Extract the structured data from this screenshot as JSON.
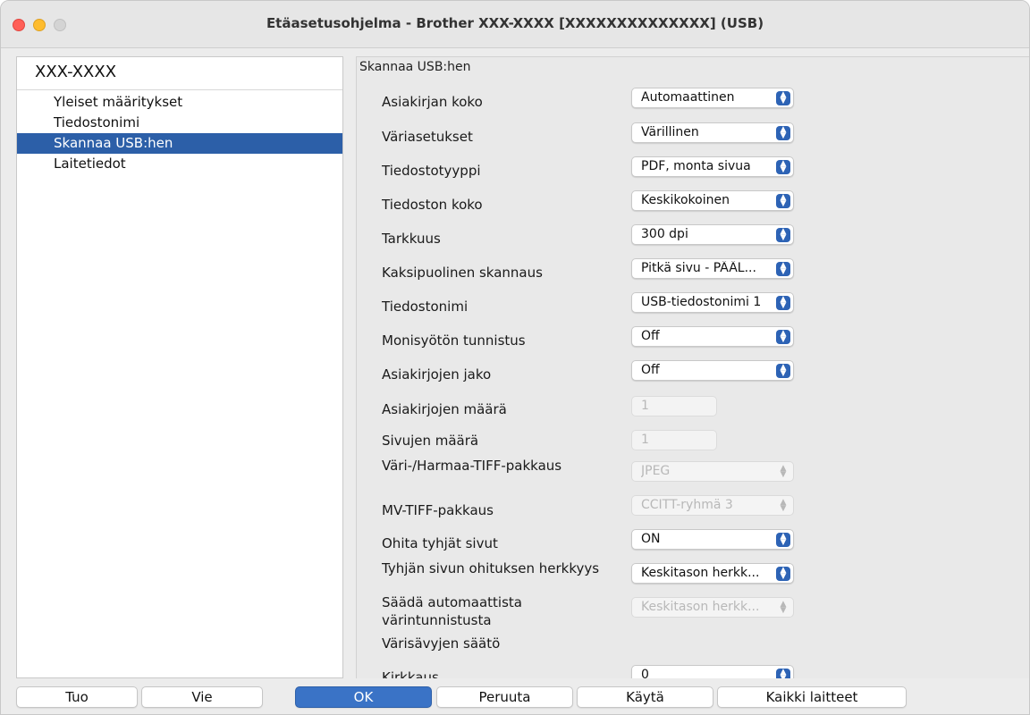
{
  "window": {
    "title": "Etäasetusohjelma - Brother XXX-XXXX [XXXXXXXXXXXXXX] (USB)"
  },
  "sidebar": {
    "header": "XXX-XXXX",
    "items": [
      {
        "label": "Yleiset määritykset"
      },
      {
        "label": "Tiedostonimi"
      },
      {
        "label": "Skannaa USB:hen",
        "selected": true
      },
      {
        "label": "Laitetiedot"
      }
    ]
  },
  "panel": {
    "section_title": "Skannaa USB:hen",
    "rows": [
      {
        "label": "Asiakirjan koko",
        "control": "popup",
        "value": "Automaattinen",
        "enabled": true
      },
      {
        "label": "Väriasetukset",
        "control": "popup",
        "value": "Värillinen",
        "enabled": true
      },
      {
        "label": "Tiedostotyyppi",
        "control": "popup",
        "value": "PDF, monta sivua",
        "enabled": true
      },
      {
        "label": "Tiedoston koko",
        "control": "popup",
        "value": "Keskikokoinen",
        "enabled": true
      },
      {
        "label": "Tarkkuus",
        "control": "popup",
        "value": "300 dpi",
        "enabled": true
      },
      {
        "label": "Kaksipuolinen skannaus",
        "control": "popup",
        "value": "Pitkä sivu - PÄÄL...",
        "enabled": true
      },
      {
        "label": "Tiedostonimi",
        "control": "popup",
        "value": "USB-tiedostonimi 1",
        "enabled": true
      },
      {
        "label": "Monisyötön tunnistus",
        "control": "popup",
        "value": "Off",
        "enabled": true
      },
      {
        "label": "Asiakirjojen jako",
        "control": "popup",
        "value": "Off",
        "enabled": true
      },
      {
        "label": "Asiakirjojen määrä",
        "control": "field",
        "value": "1",
        "enabled": false
      },
      {
        "label": "Sivujen määrä",
        "control": "field",
        "value": "1",
        "enabled": false
      },
      {
        "label": "Väri-/Harmaa-TIFF-pakkaus",
        "control": "popup",
        "value": "JPEG",
        "enabled": false
      },
      {
        "label": "MV-TIFF-pakkaus",
        "control": "popup",
        "value": "CCITT-ryhmä 3",
        "enabled": false
      },
      {
        "label": "Ohita tyhjät sivut",
        "control": "popup",
        "value": "ON",
        "enabled": true
      },
      {
        "label": "Tyhjän sivun ohituksen herkkyys",
        "control": "popup",
        "value": "Keskitason herkk...",
        "enabled": true
      },
      {
        "label": "Säädä automaattista värintunnistusta",
        "control": "popup",
        "value": "Keskitason herkk...",
        "enabled": false
      },
      {
        "label": "Värisävyjen säätö",
        "control": "none"
      },
      {
        "label": "Kirkkaus",
        "control": "popup",
        "value": "0",
        "enabled": true
      }
    ]
  },
  "buttons": {
    "import": "Tuo",
    "export": "Vie",
    "ok": "OK",
    "cancel": "Peruuta",
    "apply": "Käytä",
    "all_devices": "Kaikki laitteet"
  },
  "colors": {
    "selection": "#2c5fa8",
    "popup_arrow": "#2d63b5",
    "primary_button": "#3a73c6"
  },
  "icons": {
    "popup_arrow": "up-down-chevron-icon"
  }
}
